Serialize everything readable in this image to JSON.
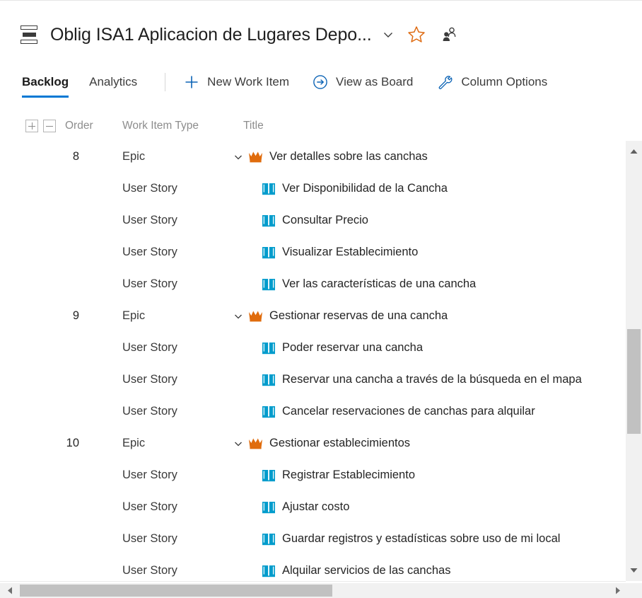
{
  "header": {
    "icon": "backlog-list-icon",
    "title": "Oblig ISA1 Aplicacion de Lugares Depo...",
    "chevron_icon": "chevron-down-icon",
    "favorite_icon": "star-icon",
    "team_icon": "people-icon",
    "accent_blue": "#0078d4",
    "star_orange": "#de6a10"
  },
  "commandbar": {
    "tabs": [
      {
        "label": "Backlog",
        "active": true
      },
      {
        "label": "Analytics",
        "active": false
      }
    ],
    "commands": [
      {
        "label": "New Work Item",
        "icon": "plus-icon"
      },
      {
        "label": "View as Board",
        "icon": "arrow-right-circle-icon"
      },
      {
        "label": "Column Options",
        "icon": "wrench-icon"
      }
    ]
  },
  "columns": {
    "expand_all_icon": "expand-all-icon",
    "collapse_all_icon": "collapse-all-icon",
    "order": "Order",
    "work_item_type": "Work Item Type",
    "title": "Title"
  },
  "colors": {
    "epic_orange": "#e06c0d",
    "story_blue": "#009ccc"
  },
  "rows": [
    {
      "order": "8",
      "type": "Epic",
      "title": "Ver detalles sobre las canchas",
      "kind": "epic",
      "icon": "crown-icon",
      "chevron": "chevron-down-icon"
    },
    {
      "order": "",
      "type": "User Story",
      "title": "Ver Disponibilidad de la Cancha",
      "kind": "story",
      "icon": "book-icon"
    },
    {
      "order": "",
      "type": "User Story",
      "title": "Consultar Precio",
      "kind": "story",
      "icon": "book-icon"
    },
    {
      "order": "",
      "type": "User Story",
      "title": "Visualizar Establecimiento",
      "kind": "story",
      "icon": "book-icon"
    },
    {
      "order": "",
      "type": "User Story",
      "title": "Ver las características de una cancha",
      "kind": "story",
      "icon": "book-icon"
    },
    {
      "order": "9",
      "type": "Epic",
      "title": "Gestionar reservas de una cancha",
      "kind": "epic",
      "icon": "crown-icon",
      "chevron": "chevron-down-icon"
    },
    {
      "order": "",
      "type": "User Story",
      "title": "Poder reservar una cancha",
      "kind": "story",
      "icon": "book-icon"
    },
    {
      "order": "",
      "type": "User Story",
      "title": "Reservar una cancha a través de la búsqueda en el mapa",
      "kind": "story",
      "icon": "book-icon"
    },
    {
      "order": "",
      "type": "User Story",
      "title": "Cancelar reservaciones de canchas para alquilar",
      "kind": "story",
      "icon": "book-icon"
    },
    {
      "order": "10",
      "type": "Epic",
      "title": "Gestionar establecimientos",
      "kind": "epic",
      "icon": "crown-icon",
      "chevron": "chevron-down-icon"
    },
    {
      "order": "",
      "type": "User Story",
      "title": "Registrar Establecimiento",
      "kind": "story",
      "icon": "book-icon"
    },
    {
      "order": "",
      "type": "User Story",
      "title": "Ajustar costo",
      "kind": "story",
      "icon": "book-icon"
    },
    {
      "order": "",
      "type": "User Story",
      "title": "Guardar registros y estadísticas sobre uso de mi local",
      "kind": "story",
      "icon": "book-icon"
    },
    {
      "order": "",
      "type": "User Story",
      "title": "Alquilar servicios de las canchas",
      "kind": "story",
      "icon": "book-icon"
    }
  ],
  "scrollbars": {
    "vertical": {
      "up_icon": "scroll-up-arrow-icon",
      "down_icon": "scroll-down-arrow-icon"
    },
    "horizontal": {
      "left_icon": "scroll-left-arrow-icon",
      "right_icon": "scroll-right-arrow-icon"
    }
  }
}
